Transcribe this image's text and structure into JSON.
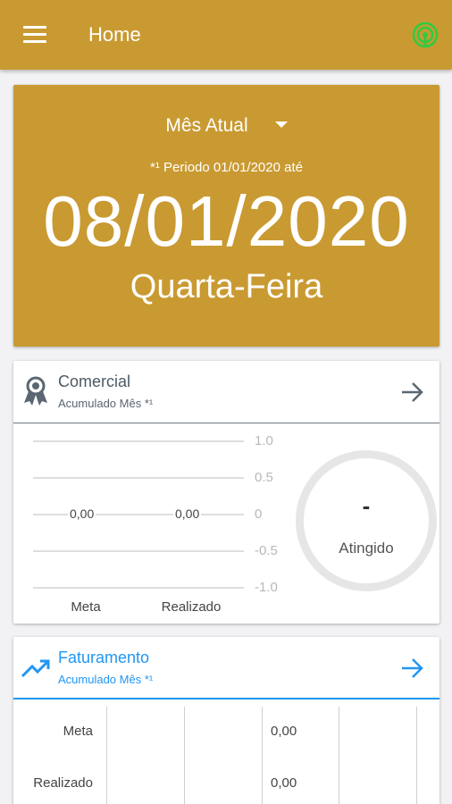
{
  "appbar": {
    "title": "Home"
  },
  "hero": {
    "period_select": "Mês Atual",
    "period_note": "*¹ Periodo 01/01/2020 até",
    "date": "08/01/2020",
    "weekday": "Quarta-Feira"
  },
  "comercial": {
    "title": "Comercial",
    "subtitle": "Acumulado Mês *¹",
    "chart_data": {
      "type": "bar",
      "categories": [
        "Meta",
        "Realizado"
      ],
      "values": [
        0,
        0
      ],
      "data_labels": [
        "0,00",
        "0,00"
      ],
      "y_ticks": [
        "1.0",
        "0.5",
        "0",
        "-0.5",
        "-1.0"
      ],
      "ylim": [
        -1,
        1
      ]
    },
    "gauge": {
      "value": "-",
      "label": "Atingido"
    }
  },
  "faturamento": {
    "title": "Faturamento",
    "subtitle": "Acumulado Mês *¹",
    "rows": [
      {
        "label": "Meta",
        "value": "0,00"
      },
      {
        "label": "Realizado",
        "value": "0,00"
      }
    ]
  },
  "colors": {
    "brand": "#c99a32",
    "accent": "#2196f3",
    "status_icon": "#2ecc40"
  },
  "icons": {
    "menu": "menu-icon",
    "status": "signal-status-icon",
    "comercial": "award-ribbon-icon",
    "faturamento": "trending-up-icon",
    "arrow": "arrow-right-icon"
  }
}
